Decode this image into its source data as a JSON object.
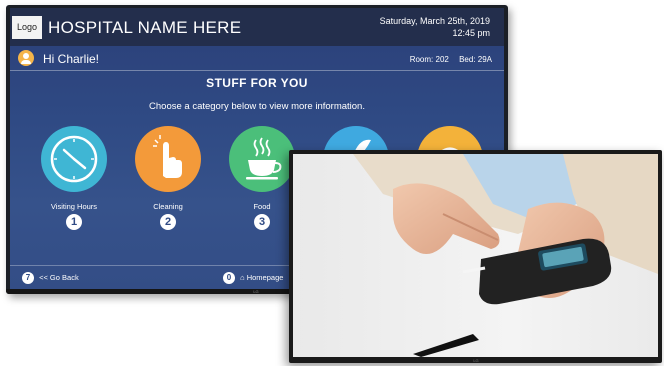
{
  "header": {
    "logo": "Logo",
    "hospital_name": "HOSPITAL NAME HERE",
    "date": "Saturday, March 25th, 2019",
    "time": "12:45 pm"
  },
  "greeting_bar": {
    "greeting": "Hi Charlie!",
    "room": "Room: 202",
    "bed": "Bed: 29A"
  },
  "main": {
    "title": "STUFF FOR YOU",
    "subtitle": "Choose a category below to view more information."
  },
  "categories": [
    {
      "label": "Visiting Hours",
      "number": "1",
      "icon": "clock-icon",
      "color": "#3fb6d4"
    },
    {
      "label": "Cleaning",
      "number": "2",
      "icon": "hand-icon",
      "color": "#f39a3a"
    },
    {
      "label": "Food",
      "number": "3",
      "icon": "coffee-cup-icon",
      "color": "#4bbf7a"
    },
    {
      "label": "",
      "number": "",
      "icon": "leaf-icon",
      "color": "#3fa9e0"
    },
    {
      "label": "",
      "number": "",
      "icon": "generic-icon",
      "color": "#f3b23a"
    }
  ],
  "footer": {
    "back_number": "7",
    "back_label": "<< Go Back",
    "home_number": "0",
    "home_label": "Homepage"
  },
  "tv_brand_back": "LG",
  "tv_brand_front": "LG"
}
